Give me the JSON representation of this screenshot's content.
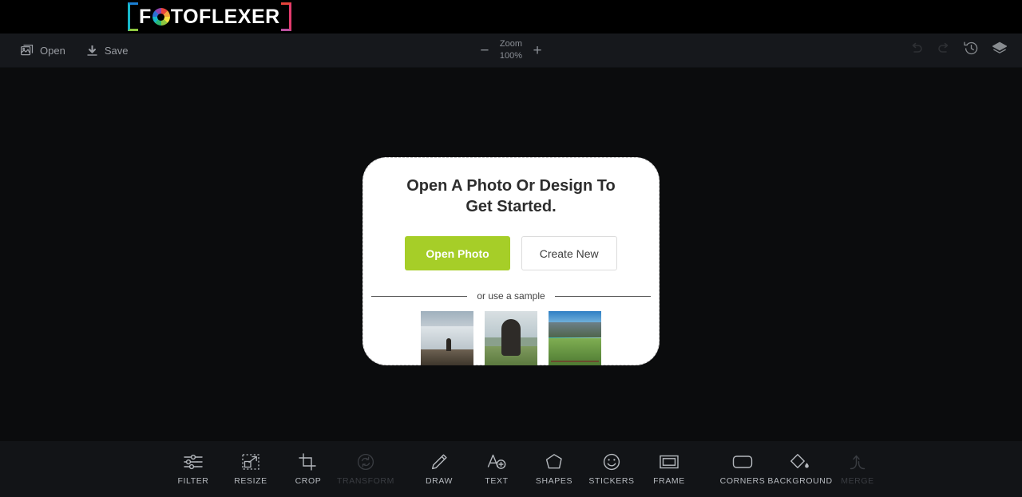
{
  "header": {
    "logo_text_before": "F",
    "logo_icon": "camera-aperture-icon",
    "logo_text_after": "TOFLEXER",
    "logo_full": "FOTOFLEXER"
  },
  "toolbar": {
    "open_label": "Open",
    "open_icon": "image-icon",
    "save_label": "Save",
    "save_icon": "download-icon",
    "zoom_out_label": "−",
    "zoom_in_label": "+",
    "zoom_title": "Zoom",
    "zoom_value": "100%",
    "undo_icon": "undo-arrow-icon",
    "redo_icon": "redo-arrow-icon",
    "history_icon": "history-clock-icon",
    "layers_icon": "layers-icon"
  },
  "modal": {
    "title": "Open A Photo Or Design To Get Started.",
    "open_photo_label": "Open Photo",
    "create_new_label": "Create New",
    "divider_label": "or use a sample",
    "samples": [
      {
        "name": "sample-cliff-clouds"
      },
      {
        "name": "sample-woman-field"
      },
      {
        "name": "sample-mountain-lake"
      }
    ]
  },
  "bottom_tools": {
    "groups": [
      {
        "items": [
          {
            "label": "FILTER",
            "icon": "sliders-icon",
            "disabled": false
          },
          {
            "label": "RESIZE",
            "icon": "resize-icon",
            "disabled": false
          },
          {
            "label": "CROP",
            "icon": "crop-icon",
            "disabled": false
          },
          {
            "label": "TRANSFORM",
            "icon": "transform-rotate-icon",
            "disabled": true
          }
        ]
      },
      {
        "items": [
          {
            "label": "DRAW",
            "icon": "pencil-icon",
            "disabled": false
          },
          {
            "label": "TEXT",
            "icon": "add-text-icon",
            "disabled": false
          },
          {
            "label": "SHAPES",
            "icon": "pentagon-icon",
            "disabled": false
          },
          {
            "label": "STICKERS",
            "icon": "smiley-icon",
            "disabled": false
          },
          {
            "label": "FRAME",
            "icon": "frame-icon",
            "disabled": false
          }
        ]
      },
      {
        "items": [
          {
            "label": "CORNERS",
            "icon": "rounded-rect-icon",
            "disabled": false
          },
          {
            "label": "BACKGROUND",
            "icon": "paint-diamond-icon",
            "disabled": false
          },
          {
            "label": "MERGE",
            "icon": "merge-arrow-icon",
            "disabled": true
          }
        ]
      }
    ]
  },
  "colors": {
    "header_bg": "#000000",
    "toolbar_bg": "#16181c",
    "canvas_bg": "#0b0c0d",
    "bottombar_bg": "#121417",
    "accent_green": "#a6ce28",
    "modal_bg": "#ffffff"
  }
}
